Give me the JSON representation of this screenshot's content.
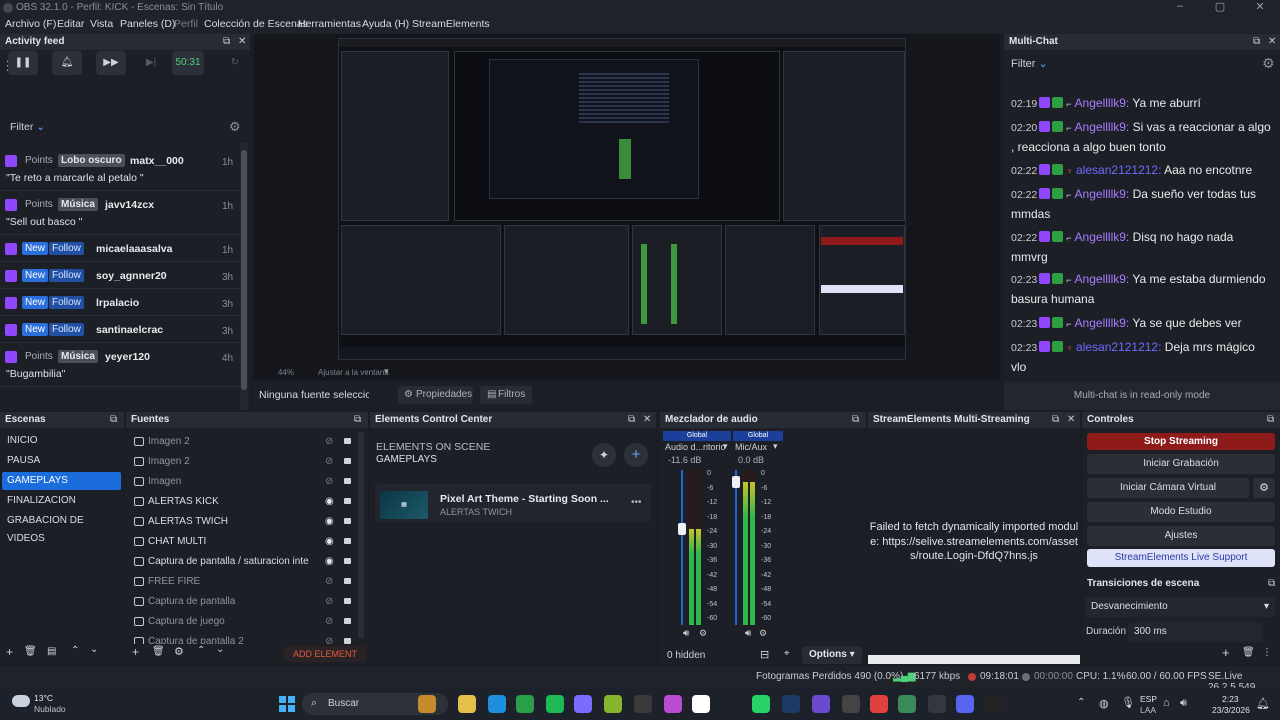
{
  "window": {
    "title": "OBS 32.1.0 - Perfil: KICK - Escenas: Sin Título"
  },
  "menu": [
    {
      "label": "Archivo (F)",
      "dim": false
    },
    {
      "label": "Editar",
      "dim": false
    },
    {
      "label": "Vista",
      "dim": false
    },
    {
      "label": "Paneles (D)",
      "dim": false
    },
    {
      "label": "Perfil",
      "dim": true
    },
    {
      "label": "Colección de Escenas",
      "dim": false
    },
    {
      "label": "Herramientas",
      "dim": false
    },
    {
      "label": "Ayuda (H)",
      "dim": false
    },
    {
      "label": "StreamElements",
      "dim": false
    }
  ],
  "activity_feed": {
    "title": "Activity feed",
    "timer": "50:31",
    "filter_label": "Filter",
    "items": [
      {
        "kind": "points",
        "tag": "Lobo oscuro",
        "user": "matx__000",
        "time": "1h",
        "message": "\"Te reto a marcarle al petalo \""
      },
      {
        "kind": "points",
        "tag": "Música",
        "user": "javv14zcx",
        "time": "1h",
        "message": "\"Sell out basco \""
      },
      {
        "kind": "follow",
        "tag": "Follow",
        "user": "micaelaaasalva",
        "time": "1h",
        "message": ""
      },
      {
        "kind": "follow",
        "tag": "Follow",
        "user": "soy_agnner20",
        "time": "3h",
        "message": ""
      },
      {
        "kind": "follow",
        "tag": "Follow",
        "user": "lrpalacio",
        "time": "3h",
        "message": ""
      },
      {
        "kind": "follow",
        "tag": "Follow",
        "user": "santinaelcrac",
        "time": "3h",
        "message": ""
      },
      {
        "kind": "points",
        "tag": "Música",
        "user": "yeyer120",
        "time": "4h",
        "message": "\"Bugambilia\""
      }
    ],
    "points_label": "Points",
    "new_label": "New"
  },
  "preview": {
    "zoom": "44%",
    "fit_label": "Ajustar a la ventana",
    "no_source": "Ninguna fuente seleccionada",
    "properties_btn": "Propiedades",
    "filters_btn": "Filtros"
  },
  "multichat": {
    "title": "Multi-Chat",
    "filter_label": "Filter",
    "footer": "Multi-chat is in read-only mode",
    "lines": [
      {
        "time": "02:19",
        "user": "Angellllk9:",
        "msg": "Ya me aburrí",
        "alt": false
      },
      {
        "time": "02:20",
        "user": "Angellllk9:",
        "msg": "Si vas a reaccionar a algo , reacciona a algo buen tonto",
        "alt": false
      },
      {
        "time": "02:22",
        "user": "alesan2121212:",
        "msg": "Aaa no encotnre",
        "alt": true
      },
      {
        "time": "02:22",
        "user": "Angellllk9:",
        "msg": "Da sueño ver todas tus mmdas",
        "alt": false
      },
      {
        "time": "02:22",
        "user": "Angellllk9:",
        "msg": "Disq no hago nada mmvrg",
        "alt": false
      },
      {
        "time": "02:23",
        "user": "Angellllk9:",
        "msg": "Ya me estaba durmiendo basura humana",
        "alt": false
      },
      {
        "time": "02:23",
        "user": "Angellllk9:",
        "msg": "Ya se que debes ver",
        "alt": false
      },
      {
        "time": "02:23",
        "user": "alesan2121212:",
        "msg": "Deja mrs mágico vlo",
        "alt": true
      }
    ]
  },
  "scenes": {
    "title": "Escenas",
    "items": [
      "INICIO",
      "PAUSA",
      "GAMEPLAYS",
      "FINALIZACION",
      "GRABACION DE VIDEOS"
    ],
    "selected": 2
  },
  "sources": {
    "title": "Fuentes",
    "items": [
      {
        "name": "Imagen 2",
        "visible": false,
        "icon": "image-icon"
      },
      {
        "name": "Imagen 2",
        "visible": false,
        "icon": "image-icon"
      },
      {
        "name": "Imagen",
        "visible": false,
        "icon": "image-icon"
      },
      {
        "name": "ALERTAS KICK",
        "visible": true,
        "icon": "browser-icon"
      },
      {
        "name": "ALERTAS TWICH",
        "visible": true,
        "icon": "browser-icon"
      },
      {
        "name": "CHAT MULTI",
        "visible": true,
        "icon": "browser-icon"
      },
      {
        "name": "Captura de pantalla / saturacion inte",
        "visible": true,
        "icon": "monitor-icon"
      },
      {
        "name": "FREE FIRE",
        "visible": false,
        "icon": "window-icon"
      },
      {
        "name": "Captura de pantalla",
        "visible": false,
        "icon": "monitor-icon"
      },
      {
        "name": "Captura de juego",
        "visible": false,
        "icon": "gamepad-icon"
      },
      {
        "name": "Captura de pantalla 2",
        "visible": false,
        "icon": "monitor-icon"
      }
    ]
  },
  "elements": {
    "title": "Elements Control Center",
    "heading": "ELEMENTS ON SCENE",
    "scene": "GAMEPLAYS",
    "card_title": "Pixel Art Theme - Starting Soon ...",
    "card_sub": "ALERTAS TWICH",
    "add_btn": "ADD ELEMENT"
  },
  "mixer": {
    "title": "Mezclador de audio",
    "channels": [
      {
        "tag": "Global",
        "name": "Audio d...ritorio",
        "db": "-11.6 dB",
        "level": 0.62
      },
      {
        "tag": "Global",
        "name": "Mic/Aux",
        "db": "0.0 dB",
        "level": 0.92
      }
    ],
    "scale": [
      "0",
      "-6",
      "-12",
      "-18",
      "-24",
      "-30",
      "-36",
      "-42",
      "-48",
      "-54",
      "-60"
    ],
    "hidden": "0 hidden",
    "options": "Options"
  },
  "multistream": {
    "title": "StreamElements Multi-Streaming",
    "error": "Failed to fetch dynamically imported module: https://selive.streamelements.com/assets/route.Login-DfdQ7hns.js"
  },
  "controls": {
    "title": "Controles",
    "stop": "Stop Streaming",
    "record": "Iniciar Grabación",
    "vcam": "Iniciar Cámara Virtual",
    "studio": "Modo Estudio",
    "settings": "Ajustes",
    "support": "StreamElements Live Support",
    "accent": "#8e1a1a"
  },
  "transitions": {
    "title": "Transiciones de escena",
    "type": "Desvanecimiento",
    "duration_label": "Duración",
    "duration": "300 ms"
  },
  "status": {
    "dropped": "Fotogramas Perdidos 490 (0.0%)",
    "kbps": "6177 kbps",
    "live_time": "09:18:01",
    "rec_time": "00:00:00",
    "cpu": "CPU: 1.1%",
    "fps": "60.00 / 60.00 FPS",
    "version": "SE.Live 26.2.5.549"
  },
  "taskbar": {
    "weather_temp": "13°C",
    "weather_desc": "Nublado",
    "search": "Buscar",
    "lang": "ESP",
    "lang2": "LAA",
    "time": "2:23",
    "date": "23/3/2026"
  }
}
